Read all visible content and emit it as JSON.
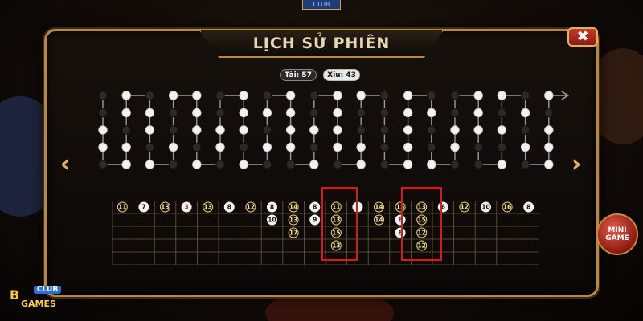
{
  "window": {
    "title": "LỊCH SỬ PHIÊN",
    "close_label": "✖",
    "top_badge": "CLUB"
  },
  "stats": {
    "tai": "Tài: 57",
    "xiu": "Xỉu: 43"
  },
  "navigation": {
    "prev": "‹",
    "next": "›"
  },
  "mini_game": {
    "line1": "MINI",
    "line2": "GAME"
  },
  "logo": {
    "club": "CLUB",
    "games": "GAMES",
    "mark": "B"
  },
  "colors": {
    "gold": "#b8893a",
    "white_bead": "#f2f2f2",
    "black_bead": "#2a2a2a",
    "highlight": "#e01515"
  },
  "trend_columns": [
    [
      "b",
      "b",
      "w",
      "w",
      "b"
    ],
    [
      "w",
      "w",
      "b",
      "w",
      "w"
    ],
    [
      "b",
      "w",
      "w",
      "b",
      "w"
    ],
    [
      "w",
      "b",
      "b",
      "w",
      "b"
    ],
    [
      "w",
      "w",
      "w",
      "b",
      "w"
    ],
    [
      "b",
      "b",
      "w",
      "w",
      "b"
    ],
    [
      "w",
      "w",
      "w",
      "b",
      "w"
    ],
    [
      "b",
      "w",
      "b",
      "w",
      "b"
    ],
    [
      "w",
      "w",
      "w",
      "w",
      "b"
    ],
    [
      "b",
      "b",
      "w",
      "b",
      "w"
    ],
    [
      "w",
      "w",
      "w",
      "w",
      "b"
    ],
    [
      "w",
      "b",
      "b",
      "w",
      "w"
    ],
    [
      "b",
      "b",
      "b",
      "b",
      "b"
    ],
    [
      "w",
      "w",
      "w",
      "w",
      "w"
    ],
    [
      "b",
      "w",
      "b",
      "b",
      "w"
    ],
    [
      "b",
      "b",
      "w",
      "w",
      "b"
    ],
    [
      "w",
      "w",
      "w",
      "b",
      "b"
    ],
    [
      "w",
      "b",
      "w",
      "b",
      "w"
    ],
    [
      "b",
      "w",
      "b",
      "w",
      "b"
    ],
    [
      "w",
      "b",
      "w",
      "w",
      "w"
    ]
  ],
  "dice_grid": {
    "columns": 20,
    "rows": 5,
    "cells": [
      {
        "c": 0,
        "r": 0,
        "v": "11",
        "t": "w"
      },
      {
        "c": 1,
        "r": 0,
        "v": "7",
        "t": "b"
      },
      {
        "c": 2,
        "r": 0,
        "v": "13",
        "t": "w"
      },
      {
        "c": 3,
        "r": 0,
        "v": "3",
        "t": "r"
      },
      {
        "c": 4,
        "r": 0,
        "v": "13",
        "t": "w"
      },
      {
        "c": 5,
        "r": 0,
        "v": "8",
        "t": "b"
      },
      {
        "c": 6,
        "r": 0,
        "v": "12",
        "t": "w"
      },
      {
        "c": 7,
        "r": 0,
        "v": "8",
        "t": "b"
      },
      {
        "c": 7,
        "r": 1,
        "v": "10",
        "t": "b"
      },
      {
        "c": 8,
        "r": 0,
        "v": "14",
        "t": "w"
      },
      {
        "c": 8,
        "r": 1,
        "v": "13",
        "t": "w"
      },
      {
        "c": 8,
        "r": 2,
        "v": "17",
        "t": "w"
      },
      {
        "c": 9,
        "r": 0,
        "v": "8",
        "t": "b"
      },
      {
        "c": 9,
        "r": 1,
        "v": "9",
        "t": "b"
      },
      {
        "c": 10,
        "r": 0,
        "v": "11",
        "t": "w"
      },
      {
        "c": 10,
        "r": 1,
        "v": "13",
        "t": "w"
      },
      {
        "c": 10,
        "r": 2,
        "v": "15",
        "t": "w"
      },
      {
        "c": 10,
        "r": 3,
        "v": "13",
        "t": "w"
      },
      {
        "c": 11,
        "r": 0,
        "v": "",
        "t": "b"
      },
      {
        "c": 12,
        "r": 0,
        "v": "14",
        "t": "w"
      },
      {
        "c": 12,
        "r": 1,
        "v": "14",
        "t": "w"
      },
      {
        "c": 13,
        "r": 0,
        "v": "15",
        "t": "w"
      },
      {
        "c": 13,
        "r": 1,
        "v": "6",
        "t": "b"
      },
      {
        "c": 13,
        "r": 2,
        "v": "6",
        "t": "b"
      },
      {
        "c": 14,
        "r": 0,
        "v": "13",
        "t": "w"
      },
      {
        "c": 14,
        "r": 1,
        "v": "15",
        "t": "w"
      },
      {
        "c": 14,
        "r": 2,
        "v": "12",
        "t": "w"
      },
      {
        "c": 14,
        "r": 3,
        "v": "12",
        "t": "w"
      },
      {
        "c": 15,
        "r": 0,
        "v": "6",
        "t": "b"
      },
      {
        "c": 16,
        "r": 0,
        "v": "12",
        "t": "w"
      },
      {
        "c": 17,
        "r": 0,
        "v": "10",
        "t": "b"
      },
      {
        "c": 18,
        "r": 0,
        "v": "16",
        "t": "w"
      },
      {
        "c": 19,
        "r": 0,
        "v": "8",
        "t": "b"
      }
    ]
  }
}
